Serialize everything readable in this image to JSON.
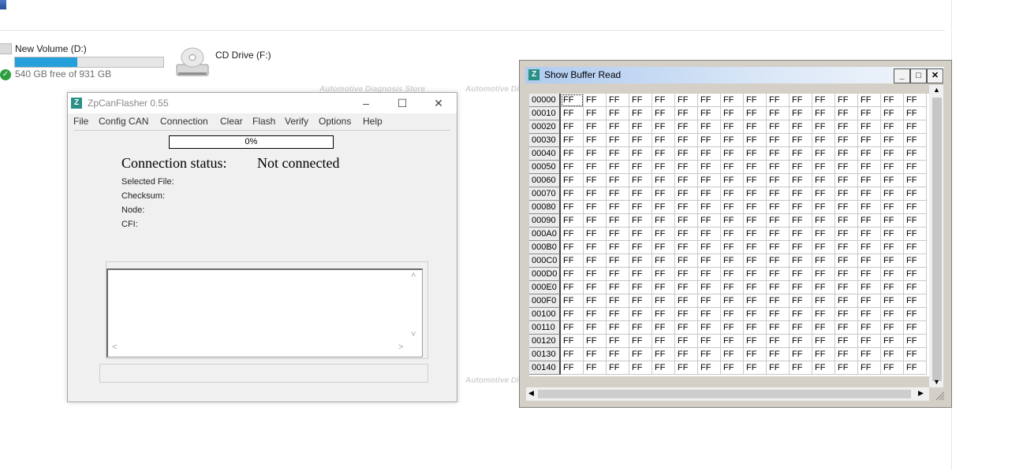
{
  "explorer": {
    "drive_d": {
      "name": "New Volume (D:)",
      "free_text": "540 GB free of 931 GB",
      "used_fraction": 0.42
    },
    "drive_f": {
      "name": "CD Drive (F:)"
    }
  },
  "watermark_text": "Automotive Diagnosis Store",
  "zpcan": {
    "title": "ZpCanFlasher 0.55",
    "menu": [
      "File",
      "Config CAN",
      "Connection",
      "Clear",
      "Flash",
      "Verify",
      "Options",
      "Help"
    ],
    "progress_text": "0%",
    "progress_value": 0,
    "connection_label": "Connection status:",
    "connection_value": "Not connected",
    "info_labels": [
      "Selected File:",
      "Checksum:",
      "Node:",
      "CFI:"
    ]
  },
  "buffer": {
    "title": "Show Buffer Read",
    "columns_per_row": 16,
    "addresses": [
      "00000",
      "00010",
      "00020",
      "00030",
      "00040",
      "00050",
      "00060",
      "00070",
      "00080",
      "00090",
      "000A0",
      "000B0",
      "000C0",
      "000D0",
      "000E0",
      "000F0",
      "00100",
      "00110",
      "00120",
      "00130",
      "00140"
    ],
    "byte_value": "FF"
  },
  "colors": {
    "drive_bar": "#26a0da",
    "app_icon": "#2a8f86",
    "buffer_title_gradient": "#aecbf0"
  }
}
